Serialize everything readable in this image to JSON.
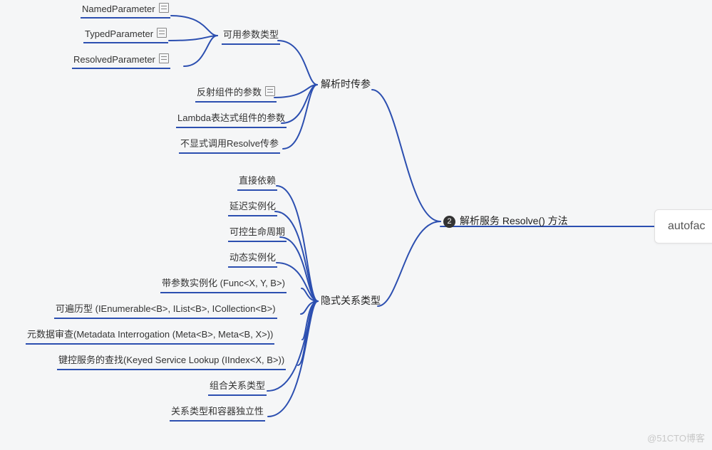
{
  "root": {
    "label": "autofac"
  },
  "center": {
    "badge": "2",
    "label": "解析服务 Resolve() 方法"
  },
  "branch_top": {
    "label": "解析时传参",
    "params_group_label": "可用参数类型",
    "param_types": [
      {
        "label": "NamedParameter",
        "note": true
      },
      {
        "label": "TypedParameter",
        "note": true
      },
      {
        "label": "ResolvedParameter",
        "note": true
      }
    ],
    "other_children": [
      {
        "label": "反射组件的参数",
        "note": true
      },
      {
        "label": "Lambda表达式组件的参数"
      },
      {
        "label": "不显式调用Resolve传参"
      }
    ]
  },
  "branch_bottom": {
    "label": "隐式关系类型",
    "children": [
      {
        "label": "直接依赖"
      },
      {
        "label": "延迟实例化"
      },
      {
        "label": "可控生命周期"
      },
      {
        "label": "动态实例化"
      },
      {
        "label": "带参数实例化 (Func<X, Y, B>)"
      },
      {
        "label": "可遍历型 (IEnumerable<B>, IList<B>, ICollection<B>)"
      },
      {
        "label": "元数据审查(Metadata Interrogation (Meta<B>, Meta<B, X>))"
      },
      {
        "label": "键控服务的查找(Keyed Service Lookup (IIndex<X, B>))"
      },
      {
        "label": "组合关系类型"
      },
      {
        "label": "关系类型和容器独立性"
      }
    ]
  },
  "watermark": "@51CTO博客",
  "chart_data": {
    "type": "mindmap",
    "root": "autofac",
    "nodes": [
      {
        "id": "center",
        "parent": "autofac",
        "label": "解析服务 Resolve() 方法"
      },
      {
        "id": "top",
        "parent": "center",
        "label": "解析时传参"
      },
      {
        "id": "top.params",
        "parent": "top",
        "label": "可用参数类型"
      },
      {
        "id": "top.params.1",
        "parent": "top.params",
        "label": "NamedParameter"
      },
      {
        "id": "top.params.2",
        "parent": "top.params",
        "label": "TypedParameter"
      },
      {
        "id": "top.params.3",
        "parent": "top.params",
        "label": "ResolvedParameter"
      },
      {
        "id": "top.2",
        "parent": "top",
        "label": "反射组件的参数"
      },
      {
        "id": "top.3",
        "parent": "top",
        "label": "Lambda表达式组件的参数"
      },
      {
        "id": "top.4",
        "parent": "top",
        "label": "不显式调用Resolve传参"
      },
      {
        "id": "bot",
        "parent": "center",
        "label": "隐式关系类型"
      },
      {
        "id": "bot.1",
        "parent": "bot",
        "label": "直接依赖"
      },
      {
        "id": "bot.2",
        "parent": "bot",
        "label": "延迟实例化"
      },
      {
        "id": "bot.3",
        "parent": "bot",
        "label": "可控生命周期"
      },
      {
        "id": "bot.4",
        "parent": "bot",
        "label": "动态实例化"
      },
      {
        "id": "bot.5",
        "parent": "bot",
        "label": "带参数实例化 (Func<X, Y, B>)"
      },
      {
        "id": "bot.6",
        "parent": "bot",
        "label": "可遍历型 (IEnumerable<B>, IList<B>, ICollection<B>)"
      },
      {
        "id": "bot.7",
        "parent": "bot",
        "label": "元数据审查(Metadata Interrogation (Meta<B>, Meta<B, X>))"
      },
      {
        "id": "bot.8",
        "parent": "bot",
        "label": "键控服务的查找(Keyed Service Lookup (IIndex<X, B>))"
      },
      {
        "id": "bot.9",
        "parent": "bot",
        "label": "组合关系类型"
      },
      {
        "id": "bot.10",
        "parent": "bot",
        "label": "关系类型和容器独立性"
      }
    ]
  }
}
